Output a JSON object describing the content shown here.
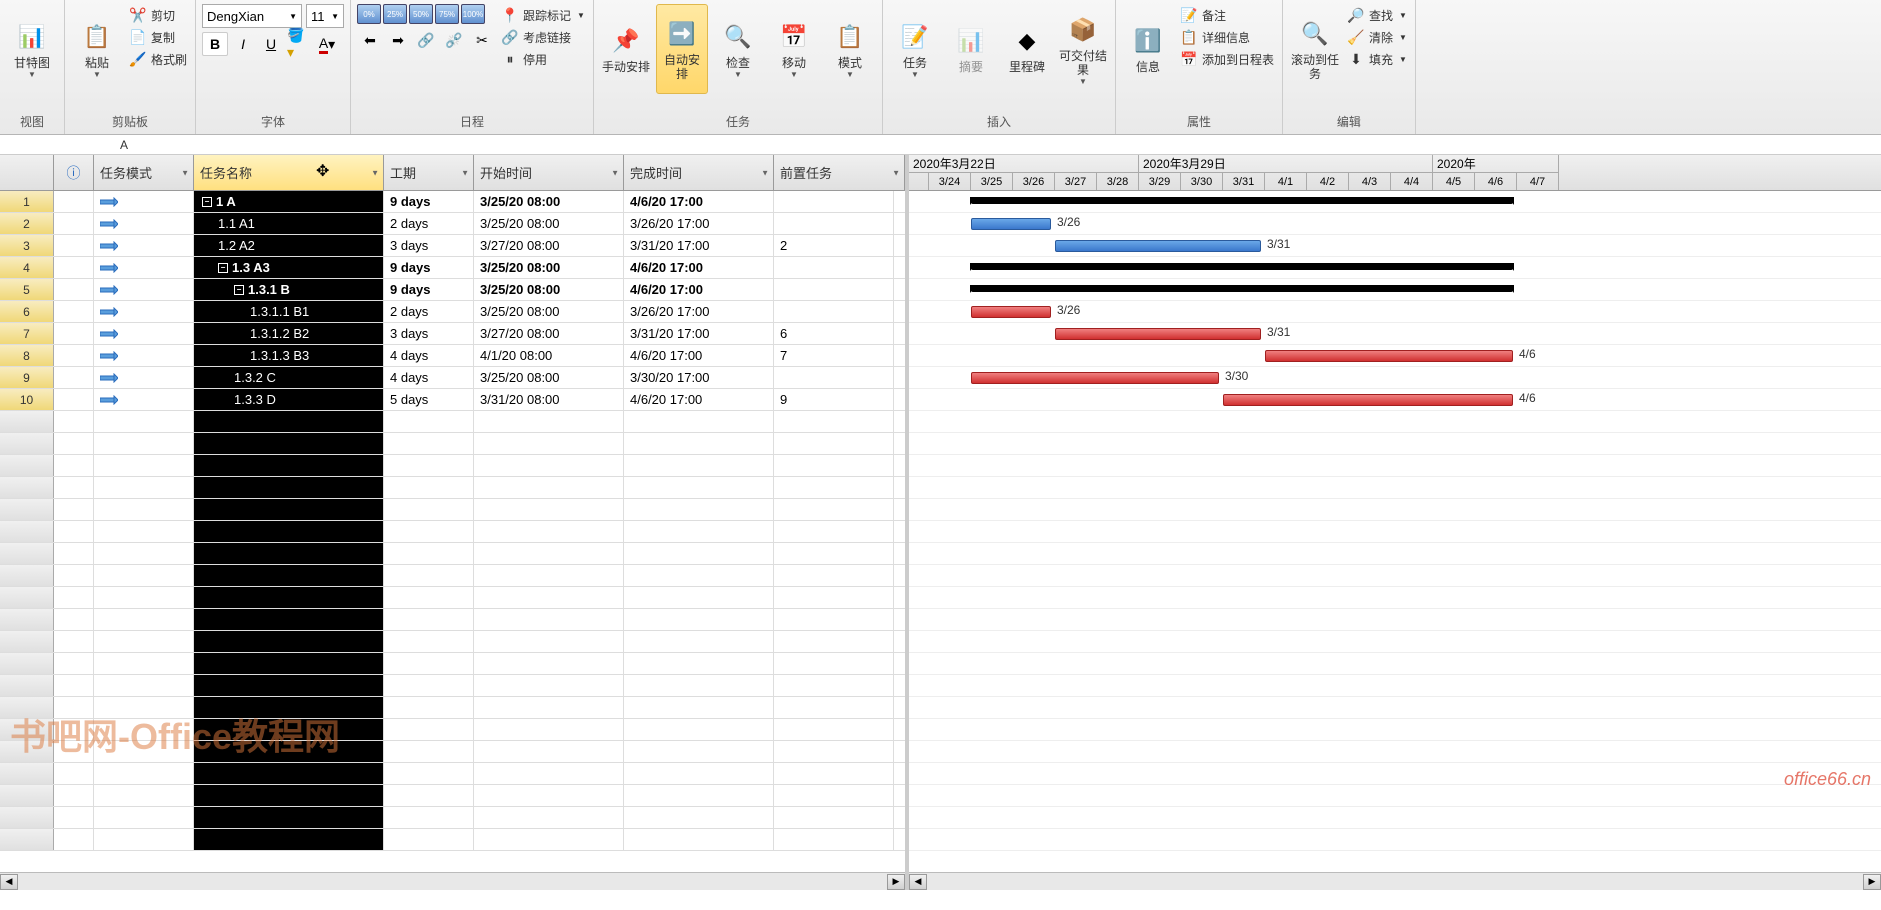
{
  "ribbon": {
    "groups": {
      "view": {
        "title": "视图",
        "gantt": "甘特图"
      },
      "clipboard": {
        "title": "剪贴板",
        "paste": "粘贴",
        "cut": "剪切",
        "copy": "复制",
        "format_painter": "格式刷"
      },
      "font": {
        "title": "字体",
        "name": "DengXian",
        "size": "11"
      },
      "schedule": {
        "title": "日程",
        "track_mark": "跟踪标记",
        "consider_link": "考虑链接",
        "pause": "停用",
        "pct0": "0%",
        "pct25": "25%",
        "pct50": "50%",
        "pct75": "75%",
        "pct100": "100%"
      },
      "tasks": {
        "title": "任务",
        "manual": "手动安排",
        "auto": "自动安排",
        "inspect": "检查",
        "move": "移动",
        "mode": "模式"
      },
      "insert": {
        "title": "插入",
        "task": "任务",
        "summary": "摘要",
        "milestone": "里程碑",
        "deliverable": "可交付结果"
      },
      "properties": {
        "title": "属性",
        "info": "信息",
        "notes": "备注",
        "details": "详细信息",
        "add_timeline": "添加到日程表"
      },
      "editing": {
        "title": "编辑",
        "scroll_to": "滚动到任务",
        "find": "查找",
        "clear": "清除",
        "fill": "填充"
      }
    }
  },
  "formula_bar": {
    "value": "A"
  },
  "columns": {
    "mode": "任务模式",
    "name": "任务名称",
    "duration": "工期",
    "start": "开始时间",
    "finish": "完成时间",
    "predecessors": "前置任务"
  },
  "timeline": {
    "weeks": [
      "2020年3月22日",
      "2020年3月29日",
      "2020年"
    ],
    "days": [
      "3/24",
      "3/25",
      "3/26",
      "3/27",
      "3/28",
      "3/29",
      "3/30",
      "3/31",
      "4/1",
      "4/2",
      "4/3",
      "4/4",
      "4/5",
      "4/6",
      "4/7"
    ]
  },
  "tasks": [
    {
      "id": 1,
      "lvl": 0,
      "name": "1 A",
      "dur": "9 days",
      "start": "3/25/20 08:00",
      "end": "4/6/20 17:00",
      "pred": "",
      "bold": true,
      "type": "summary",
      "g_start": 1,
      "g_end": 13,
      "label": ""
    },
    {
      "id": 2,
      "lvl": 1,
      "name": "1.1 A1",
      "dur": "2 days",
      "start": "3/25/20 08:00",
      "end": "3/26/20 17:00",
      "pred": "",
      "bold": false,
      "type": "blue",
      "g_start": 1,
      "g_end": 2,
      "label": "3/26"
    },
    {
      "id": 3,
      "lvl": 1,
      "name": "1.2 A2",
      "dur": "3 days",
      "start": "3/27/20 08:00",
      "end": "3/31/20 17:00",
      "pred": "2",
      "bold": false,
      "type": "blue",
      "g_start": 3,
      "g_end": 7,
      "label": "3/31"
    },
    {
      "id": 4,
      "lvl": 1,
      "name": "1.3 A3",
      "dur": "9 days",
      "start": "3/25/20 08:00",
      "end": "4/6/20 17:00",
      "pred": "",
      "bold": true,
      "type": "summary",
      "g_start": 1,
      "g_end": 13,
      "label": ""
    },
    {
      "id": 5,
      "lvl": 2,
      "name": "1.3.1 B",
      "dur": "9 days",
      "start": "3/25/20 08:00",
      "end": "4/6/20 17:00",
      "pred": "",
      "bold": true,
      "type": "summary",
      "g_start": 1,
      "g_end": 13,
      "label": ""
    },
    {
      "id": 6,
      "lvl": 3,
      "name": "1.3.1.1 B1",
      "dur": "2 days",
      "start": "3/25/20 08:00",
      "end": "3/26/20 17:00",
      "pred": "",
      "bold": false,
      "type": "red",
      "g_start": 1,
      "g_end": 2,
      "label": "3/26"
    },
    {
      "id": 7,
      "lvl": 3,
      "name": "1.3.1.2 B2",
      "dur": "3 days",
      "start": "3/27/20 08:00",
      "end": "3/31/20 17:00",
      "pred": "6",
      "bold": false,
      "type": "red",
      "g_start": 3,
      "g_end": 7,
      "label": "3/31"
    },
    {
      "id": 8,
      "lvl": 3,
      "name": "1.3.1.3 B3",
      "dur": "4 days",
      "start": "4/1/20 08:00",
      "end": "4/6/20 17:00",
      "pred": "7",
      "bold": false,
      "type": "red",
      "g_start": 8,
      "g_end": 13,
      "label": "4/6"
    },
    {
      "id": 9,
      "lvl": 2,
      "name": "1.3.2 C",
      "dur": "4 days",
      "start": "3/25/20 08:00",
      "end": "3/30/20 17:00",
      "pred": "",
      "bold": false,
      "type": "red",
      "g_start": 1,
      "g_end": 6,
      "label": "3/30"
    },
    {
      "id": 10,
      "lvl": 2,
      "name": "1.3.3 D",
      "dur": "5 days",
      "start": "3/31/20 08:00",
      "end": "4/6/20 17:00",
      "pred": "9",
      "bold": false,
      "type": "red",
      "g_start": 7,
      "g_end": 13,
      "label": "4/6"
    }
  ],
  "watermark": "书吧网-Office教程网",
  "watermark2": "office66.cn"
}
